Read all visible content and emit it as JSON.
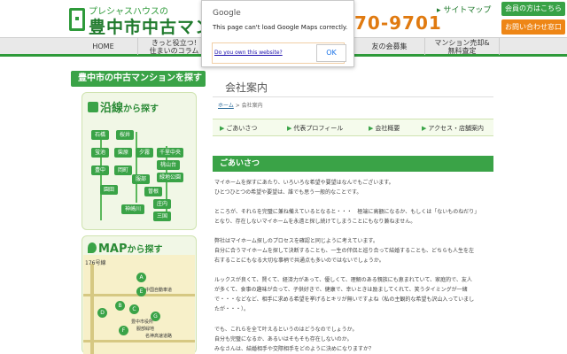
{
  "header": {
    "logo_sub": "プレシャスハウスの",
    "logo_main": "豊中市中古マンシ",
    "sitemap": "▸ サイトマップ",
    "phone": "70-9701",
    "member_label": "会員の方はこちら",
    "contact_label": "お問い合わせ窓口"
  },
  "nav": {
    "items": [
      {
        "label": "HOME"
      },
      {
        "label": "きっと役立つ!\n住まいのコラム"
      },
      {
        "label": "友の会募集"
      },
      {
        "label": "マンション売却&\n無料査定"
      }
    ]
  },
  "sidebar": {
    "title": "豊中市の中古マンションを探す",
    "line_box_title": "沿線",
    "line_box_suffix": "から探す",
    "stations": [
      "石橋",
      "桜井",
      "蛍池",
      "柴原",
      "夕霧",
      "千里中央",
      "豊中",
      "岡町",
      "桃山台",
      "服部",
      "曽根",
      "緑地公園",
      "庄内",
      "神崎川",
      "三国",
      "園田"
    ],
    "map_box_title": "MAP",
    "map_box_suffix": "から探す",
    "map_route": "176号線",
    "map_road1": "中国自動車道",
    "map_road2": "名神高速道路",
    "map_label1": "豊中市役所",
    "map_label2": "服部緑地",
    "map_pins": [
      "A",
      "B",
      "C",
      "D",
      "E",
      "F",
      "G"
    ]
  },
  "main": {
    "title": "会社案内",
    "breadcrumb_home": "ホーム",
    "breadcrumb_sep": " > ",
    "breadcrumb_current": "会社案内",
    "tabs": [
      "ごあいさつ",
      "代表プロフィール",
      "会社概要",
      "アクセス・店舗案内"
    ],
    "section_title": "ごあいさつ",
    "paragraphs": [
      "マイホームを探すにあたり、いろいろな希望や要望はなんでもございます。",
      "ひとつひとつの希望や要望は、誰でも思う一般的なことです。",
      "ところが、それらを完璧に兼ね備えているとなると・・・　極端に高額になるか、もしくは「ないものねだり」",
      "となり、存在しないマイホームを永遠と探し続けてしまうことにもなり兼ねません。",
      "弊社はマイホーム探しのプロセスを確認と同じように考えています。",
      "自分に合うマイホームを探して決断することも、一生の伴侶と巡り合って結婚することも、どちらも人生を左",
      "右することにもなる大切な事柄で共通点も多いのではないでしょうか。",
      "ルックスが良くて、賢くて、経済力があって、優しくて、理解のある親族にも恵まれていて、家庭的で、友人",
      "が多くて、食事の趣味が合って、子供好きで、健康で、幸いときは励ましてくれて、笑うタイミングが一緒",
      "で・・・などなど、相手に求める希望を挙げるとキリが無いですよね（私の主観的な希望も沢山入っていまし",
      "たが・・・）。",
      "でも、これらを全て叶えるというのはどうなのでしょうか。",
      "自分も完璧になるか、あるいはそもそも存在しないのか。",
      "みなさんは、結婚相手や交際相手をどのように決めになりますか？"
    ]
  },
  "dialog": {
    "title": "Google",
    "message": "This page can't load Google Maps correctly.",
    "link": "Do you own this website?",
    "ok": "OK"
  },
  "colors": {
    "brand_green": "#3aa347",
    "accent_orange": "#ef8a17"
  }
}
